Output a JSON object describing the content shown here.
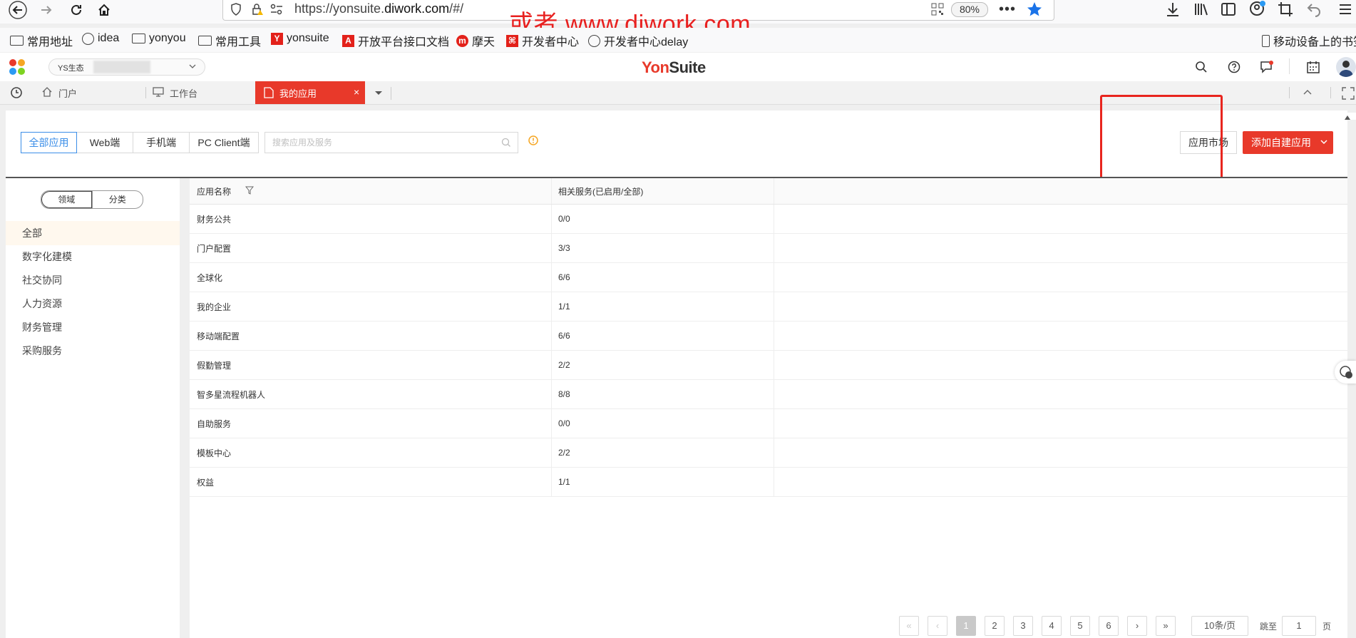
{
  "browser": {
    "url_prefix": "https://yonsuite.",
    "url_domain": "diwork.com",
    "url_suffix": "/#/",
    "zoom": "80%",
    "overlay_text": "或者  www.diwork.com",
    "bookmarks": [
      "常用地址",
      "idea",
      "yonyou",
      "常用工具",
      "yonsuite",
      "开放平台接口文档",
      "摩天",
      "开发者中心",
      "开发者中心delay"
    ],
    "mobile_bookmarks": "移动设备上的书签"
  },
  "app": {
    "env_label": "YS生态",
    "logo_yon": "Yon",
    "logo_suite": "Suite"
  },
  "tabs": [
    {
      "label": "门户"
    },
    {
      "label": "工作台"
    },
    {
      "label": "我的应用",
      "close": "×"
    }
  ],
  "filters": [
    "全部应用",
    "Web端",
    "手机端",
    "PC Client端"
  ],
  "search_placeholder": "搜索应用及服务",
  "market_button": "应用市场",
  "add_button": "添加自建应用",
  "sidebar": {
    "segments": [
      "领域",
      "分类"
    ],
    "categories": [
      "全部",
      "数字化建模",
      "社交协同",
      "人力资源",
      "财务管理",
      "采购服务"
    ]
  },
  "table": {
    "headers": [
      "应用名称",
      "相关服务(已启用/全部)"
    ],
    "rows": [
      [
        "财务公共",
        "0/0"
      ],
      [
        "门户配置",
        "3/3"
      ],
      [
        "全球化",
        "6/6"
      ],
      [
        "我的企业",
        "1/1"
      ],
      [
        "移动端配置",
        "6/6"
      ],
      [
        "假勤管理",
        "2/2"
      ],
      [
        "智多星流程机器人",
        "8/8"
      ],
      [
        "自助服务",
        "0/0"
      ],
      [
        "模板中心",
        "2/2"
      ],
      [
        "权益",
        "1/1"
      ]
    ]
  },
  "pagination": {
    "first": "«",
    "prev": "‹",
    "pages": [
      "1",
      "2",
      "3",
      "4",
      "5",
      "6"
    ],
    "current": "1",
    "next": "›",
    "last": "»",
    "page_size": "10条/页",
    "goto_label": "跳至",
    "goto_value": "1",
    "page_unit": "页"
  }
}
